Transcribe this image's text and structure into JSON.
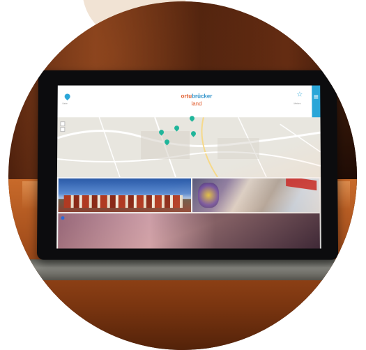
{
  "photo": {
    "subject": "tablet-kiosk",
    "screen": {
      "logo": {
        "line1_part1": "ortu",
        "line1_part2": "brücker",
        "line2": "land"
      },
      "header_left_label": "Karte",
      "header_right_label": "Merken"
    }
  },
  "colors": {
    "accent": "#2aa6d8",
    "logo_orange": "#e05a2a",
    "map_pin": "#1fb59a",
    "background_disc": "#f1e3d4"
  },
  "icons": [
    "map-pin-icon",
    "star-icon",
    "menu-icon"
  ]
}
